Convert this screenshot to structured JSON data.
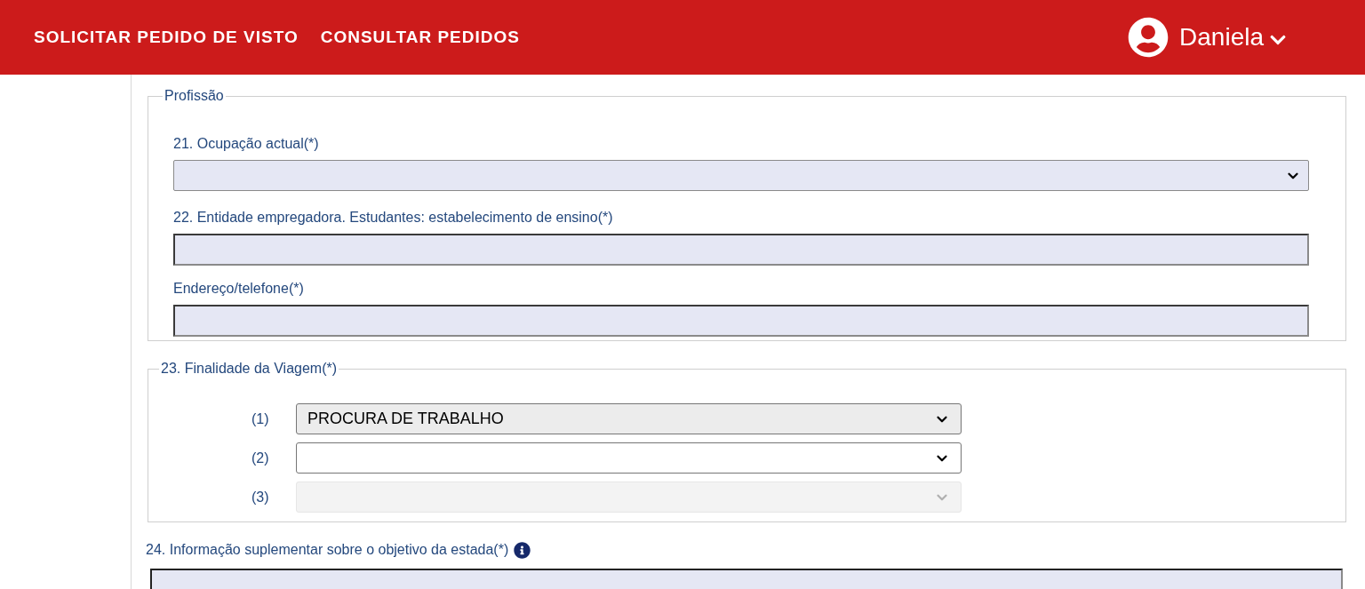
{
  "nav": {
    "links": [
      "SOLICITAR PEDIDO DE VISTO",
      "CONSULTAR PEDIDOS"
    ],
    "user": "Daniela"
  },
  "profession": {
    "legend": "Profissão",
    "fields": [
      {
        "kind": "select",
        "label": "21. Ocupação actual(*)"
      },
      {
        "kind": "text",
        "label": "22. Entidade empregadora. Estudantes: estabelecimento de ensino(*)"
      },
      {
        "kind": "text",
        "label": "Endereço/telefone(*)"
      }
    ]
  },
  "purpose": {
    "legend": "23. Finalidade da Viagem(*)",
    "selects": [
      {
        "number": "(1)",
        "value": "PROCURA DE TRABALHO",
        "disabled": false
      },
      {
        "number": "(2)",
        "disabled": false
      },
      {
        "number": "(3)",
        "disabled": true
      }
    ]
  },
  "extra_info": {
    "label": "24. Informação suplementar sobre o objetivo da estada(*)"
  }
}
